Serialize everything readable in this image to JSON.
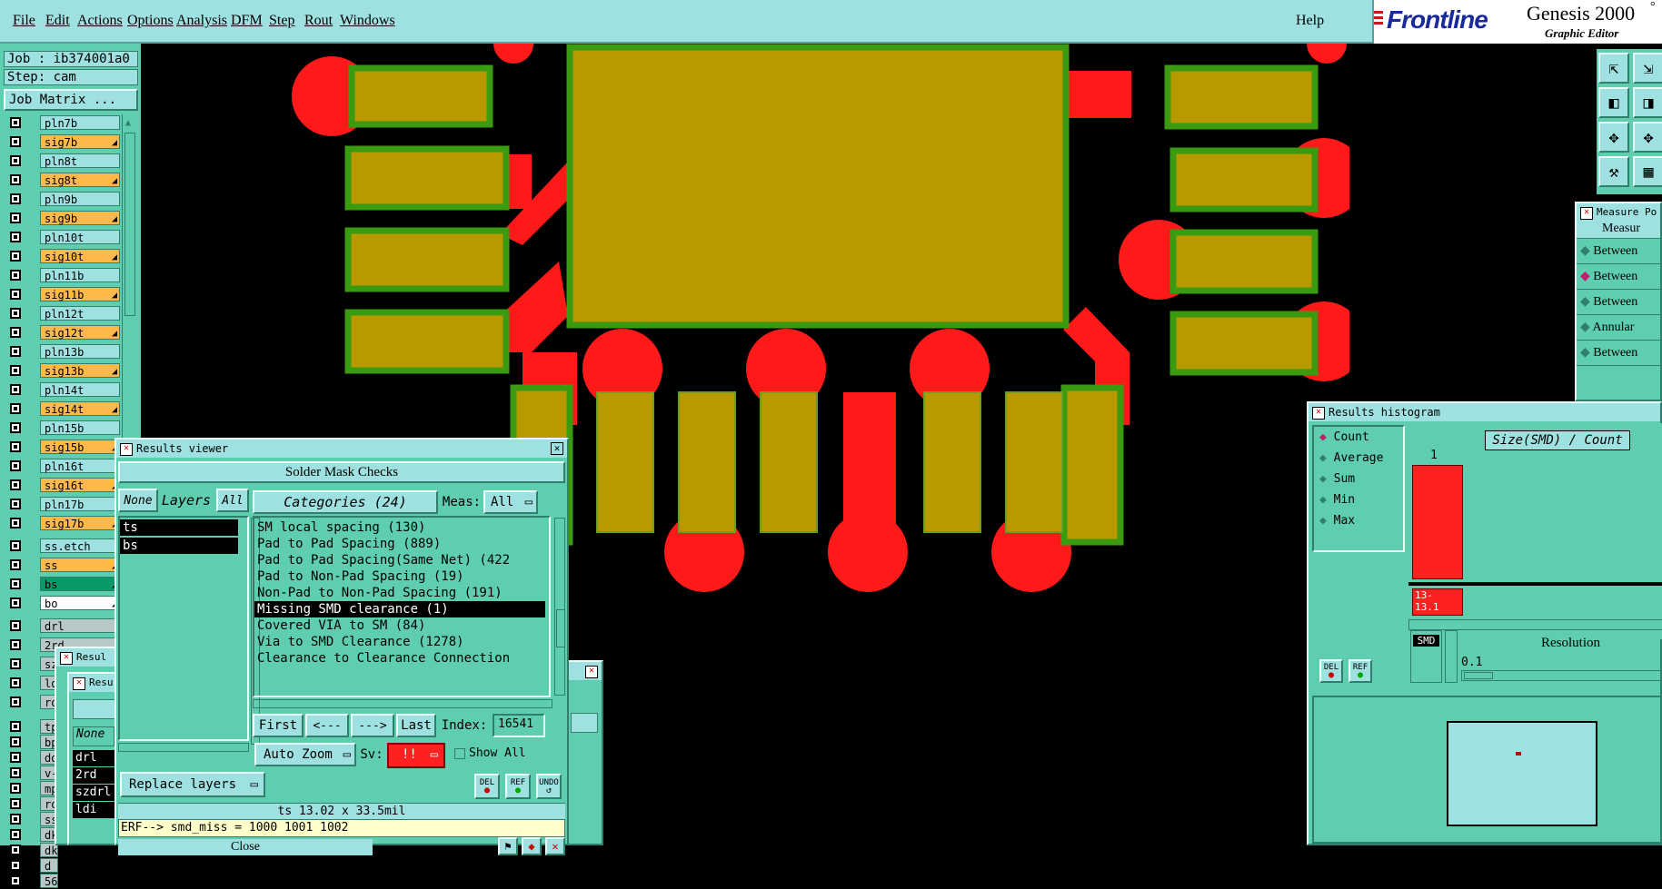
{
  "menubar": {
    "items": [
      "File",
      "Edit",
      "Actions",
      "Options",
      "Analysis",
      "DFM",
      "Step",
      "Rout",
      "Windows"
    ],
    "help": "Help"
  },
  "brand": {
    "logo": "Frontline",
    "product": "Genesis 2000",
    "product_suffix": "°",
    "subtitle": "Graphic Editor"
  },
  "left_panel": {
    "job": "Job : ib374001a0",
    "step": "Step: cam",
    "job_matrix": "Job Matrix ...",
    "layers": [
      {
        "name": "pln7b",
        "color": "#9fe0e0",
        "arrow": ""
      },
      {
        "name": "sig7b",
        "color": "#ffb84a",
        "arrow": "◢"
      },
      {
        "name": "pln8t",
        "color": "#9fe0e0",
        "arrow": ""
      },
      {
        "name": "sig8t",
        "color": "#ffb84a",
        "arrow": "◢"
      },
      {
        "name": "pln9b",
        "color": "#9fe0e0",
        "arrow": ""
      },
      {
        "name": "sig9b",
        "color": "#ffb84a",
        "arrow": "◢"
      },
      {
        "name": "pln10t",
        "color": "#9fe0e0",
        "arrow": ""
      },
      {
        "name": "sig10t",
        "color": "#ffb84a",
        "arrow": "◢"
      },
      {
        "name": "pln11b",
        "color": "#9fe0e0",
        "arrow": ""
      },
      {
        "name": "sig11b",
        "color": "#ffb84a",
        "arrow": "◢"
      },
      {
        "name": "pln12t",
        "color": "#9fe0e0",
        "arrow": ""
      },
      {
        "name": "sig12t",
        "color": "#ffb84a",
        "arrow": "◢"
      },
      {
        "name": "pln13b",
        "color": "#9fe0e0",
        "arrow": ""
      },
      {
        "name": "sig13b",
        "color": "#ffb84a",
        "arrow": "◢"
      },
      {
        "name": "pln14t",
        "color": "#9fe0e0",
        "arrow": ""
      },
      {
        "name": "sig14t",
        "color": "#ffb84a",
        "arrow": "◢"
      },
      {
        "name": "pln15b",
        "color": "#9fe0e0",
        "arrow": ""
      },
      {
        "name": "sig15b",
        "color": "#ffb84a",
        "arrow": "◢"
      },
      {
        "name": "pln16t",
        "color": "#9fe0e0",
        "arrow": ""
      },
      {
        "name": "sig16t",
        "color": "#ffb84a",
        "arrow": "◢"
      },
      {
        "name": "pln17b",
        "color": "#9fe0e0",
        "arrow": ""
      },
      {
        "name": "sig17b",
        "color": "#ffb84a",
        "arrow": "◢"
      }
    ],
    "layers2": [
      {
        "name": "ss.etch",
        "color": "#9fe0e0",
        "arrow": ""
      },
      {
        "name": "ss",
        "color": "#ffb84a",
        "arrow": "◢"
      },
      {
        "name": "bs",
        "color": "#0a9a6a",
        "arrow": "◢"
      },
      {
        "name": "bo",
        "color": "#ffffff",
        "arrow": "◢"
      }
    ],
    "layers3": [
      {
        "name": "drl",
        "color": "#b8c8c8",
        "arrow": ""
      },
      {
        "name": "2rd",
        "color": "#b8c8c8",
        "arrow": ""
      },
      {
        "name": "szdrl",
        "color": "#b8c8c8",
        "arrow": ""
      },
      {
        "name": "ld",
        "color": "#b8c8c8",
        "arrow": ""
      },
      {
        "name": "ro",
        "color": "#b8c8c8",
        "arrow": ""
      }
    ],
    "layers4": [
      "tp",
      "bp",
      "dd",
      "v-",
      "mp",
      "ro",
      "ss",
      "dk",
      "dk",
      "d",
      "56"
    ]
  },
  "results_viewer": {
    "title": "Results viewer",
    "header": "Solder Mask Checks",
    "none_label": "None",
    "layers_label": "Layers",
    "all_label": "All",
    "categories_label": "Categories (24)",
    "meas_label": "Meas:",
    "meas_value": "All",
    "layer_list": [
      "ts",
      "bs"
    ],
    "categories": [
      "SM local spacing (130)",
      "Pad to Pad Spacing (889)",
      "Pad to Pad Spacing(Same Net) (422",
      "Pad to Non-Pad Spacing (19)",
      "Non-Pad to Non-Pad Spacing (191)",
      "Missing SMD clearance (1)",
      "Covered VIA to SM (84)",
      "Via to SMD Clearance (1278)",
      "Clearance to Clearance Connection"
    ],
    "selected_category": 5,
    "first": "First",
    "prev": "<---",
    "next": "--->",
    "last": "Last",
    "index_label": "Index:",
    "index_value": "16541",
    "auto_zoom": "Auto Zoom",
    "sv_label": "Sv:",
    "sv_value": "!!",
    "show_all": "Show All",
    "replace_layers": "Replace layers",
    "del": "DEL",
    "ref": "REF",
    "undo": "UNDO",
    "status": "ts 13.02 x 33.5mil",
    "erf": "ERF--> smd_miss = 1000 1001 1002",
    "close": "Close"
  },
  "bg_result_windows": {
    "w1_title": "Resul",
    "w2_title": "Resu",
    "none_label": "None",
    "list": [
      "drl",
      "2rd",
      "szdrl",
      "ldi"
    ]
  },
  "measure_popup": {
    "title": "Measure Po",
    "header": "Measur",
    "options": [
      "Between",
      "Between",
      "Between",
      "Annular",
      "Between"
    ],
    "selected": 1
  },
  "histogram": {
    "title": "Results histogram",
    "options": [
      "Count",
      "Average",
      "Sum",
      "Min",
      "Max"
    ],
    "selected": 0,
    "chart_title": "Size(SMD) / Count",
    "bar_value": "1",
    "bar_label": "13-\n13.1",
    "smd_label": "SMD",
    "resolution_label": "Resolution",
    "resolution_value": "0.1",
    "del": "DEL",
    "ref": "REF"
  },
  "colors": {
    "pad": "#b89a00",
    "pad_border": "#3a9a10",
    "copper_red": "#ff1a1a",
    "panel": "#5fcdb0",
    "light_panel": "#9fe0e0"
  }
}
